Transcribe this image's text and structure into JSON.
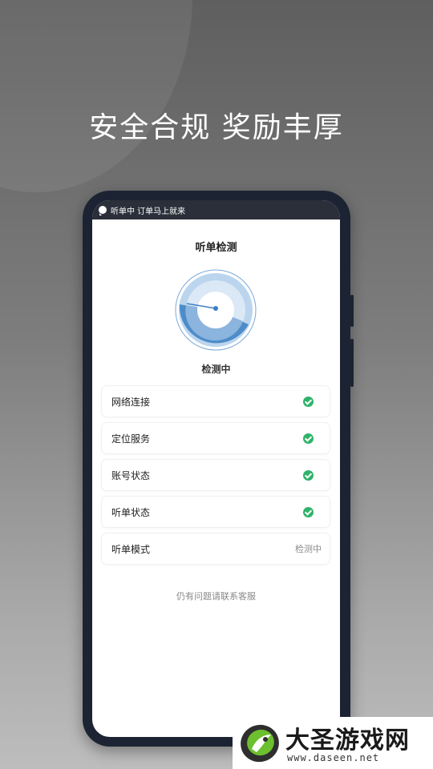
{
  "headline": "安全合规 奖励丰厚",
  "notification": {
    "text": "听单中 订单马上就来"
  },
  "screen": {
    "title": "听单检测",
    "gauge_status": "检测中",
    "checks": [
      {
        "label": "网络连接",
        "state": "ok"
      },
      {
        "label": "定位服务",
        "state": "ok"
      },
      {
        "label": "账号状态",
        "state": "ok"
      },
      {
        "label": "听单状态",
        "state": "ok"
      },
      {
        "label": "听单模式",
        "state": "pending",
        "status_text": "检测中"
      }
    ],
    "help_text": "仍有问题请联系客服"
  },
  "watermark": {
    "name": "大圣游戏网",
    "url": "www.daseen.net"
  },
  "colors": {
    "accent_blue": "#3b7fc4",
    "check_green": "#2fb36a",
    "notification_bg": "#2b2f3a",
    "phone_frame": "#1c2433"
  },
  "icons": [
    "chat-bubble-icon",
    "check-circle-icon",
    "gauge-icon",
    "brand-logo-icon"
  ]
}
